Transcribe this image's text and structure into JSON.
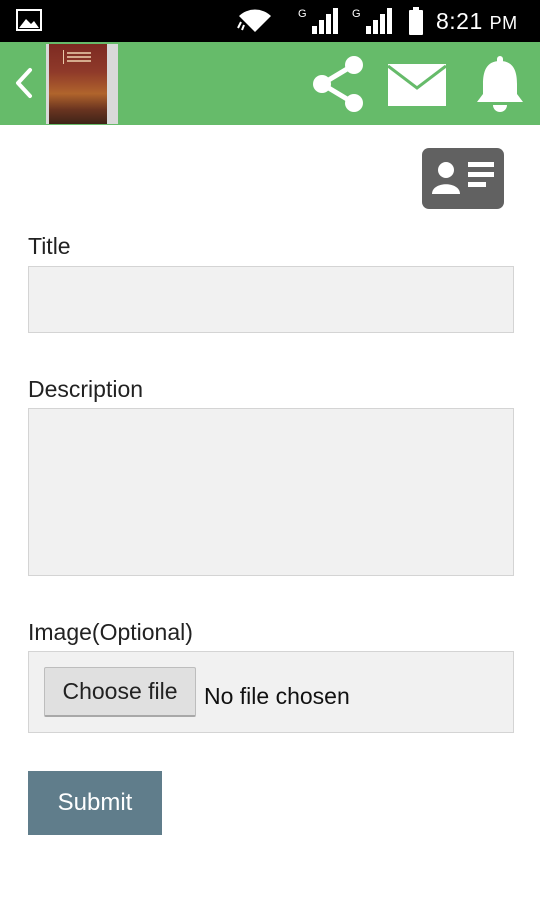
{
  "status_bar": {
    "time": "8:21",
    "ampm": "PM",
    "network_label_1": "G",
    "network_label_2": "G",
    "icons": [
      "gallery-icon",
      "wifi-icon",
      "signal-icon",
      "signal-icon",
      "battery-icon"
    ]
  },
  "app_bar": {
    "color": "#66bb6a",
    "icons": [
      "back-icon",
      "share-icon",
      "mail-icon",
      "bell-icon"
    ]
  },
  "contact_card": {
    "icon": "contact-card-icon",
    "color": "#616161"
  },
  "form": {
    "title_label": "Title",
    "title_value": "",
    "description_label": "Description",
    "description_value": "",
    "image_label": "Image(Optional)",
    "choose_file_label": "Choose file",
    "file_status": "No file chosen",
    "submit_label": "Submit",
    "submit_color": "#607d8b"
  }
}
